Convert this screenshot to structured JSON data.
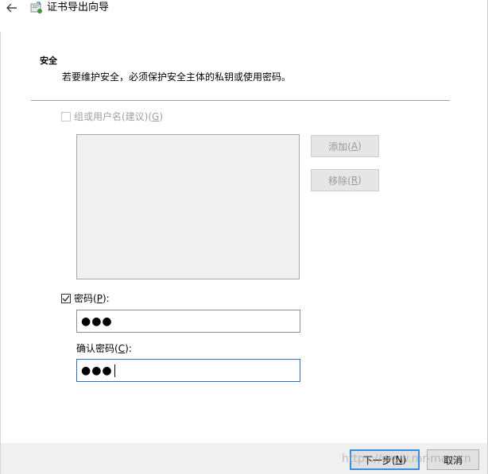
{
  "window": {
    "title": "证书导出向导",
    "back_icon": "arrow-left-icon",
    "app_icon": "certificate-wizard-icon"
  },
  "header": {
    "section_title": "安全",
    "description": "若要维护安全，必须保护安全主体的私钥或使用密码。"
  },
  "group_option": {
    "label": "组或用户名(建议)(",
    "mnemonic": "G",
    "suffix": ")",
    "checked": false,
    "enabled": false
  },
  "list_buttons": {
    "add": {
      "label": "添加(",
      "mnemonic": "A",
      "suffix": ")"
    },
    "remove": {
      "label": "移除(",
      "mnemonic": "R",
      "suffix": ")"
    }
  },
  "password_option": {
    "label": "密码(",
    "mnemonic": "P",
    "suffix": "):",
    "checked": true
  },
  "password_field": {
    "value": "●●●"
  },
  "confirm_label": {
    "label": "确认密码(",
    "mnemonic": "C",
    "suffix": "):"
  },
  "confirm_field": {
    "value": "●●●"
  },
  "footer": {
    "next": {
      "label": "下一步(",
      "mnemonic": "N",
      "suffix": ")"
    },
    "cancel": "取消"
  },
  "watermark": "https://www.mr-mao.cn",
  "colors": {
    "focus_border": "#2d72c4",
    "primary_border": "#3c8ce0",
    "footer_bg": "#f0f0f0",
    "disabled_text": "#a0a0a0"
  }
}
